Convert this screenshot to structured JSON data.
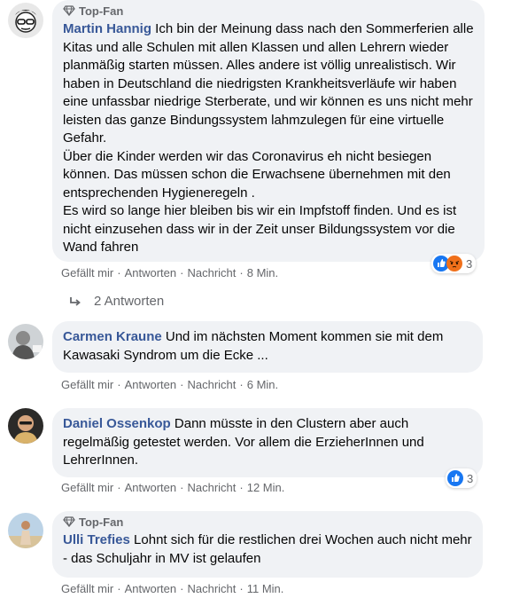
{
  "comments": [
    {
      "top_fan": "Top-Fan",
      "author": "Martin Hannig",
      "text": "Ich bin der Meinung dass nach den Sommerferien alle Kitas und alle Schulen mit allen Klassen und allen Lehrern wieder planmäßig starten müssen. Alles andere ist völlig unrealistisch. Wir haben in Deutschland die niedrigsten Krankheitsverläufe wir haben eine unfassbar niedrige Sterberate, und wir können es uns nicht mehr leisten das ganze Bindungssystem lahmzulegen für eine virtuelle Gefahr.\nÜber die Kinder werden wir das Coronavirus eh nicht besiegen können. Das müssen schon die Erwachsene übernehmen mit den entsprechenden Hygieneregeln .\nEs wird so lange hier bleiben bis wir ein Impfstoff finden. Und es ist nicht einzusehen dass wir in der Zeit unser Bildungssystem vor die Wand fahren",
      "like": "Gefällt mir",
      "reply": "Antworten",
      "message": "Nachricht",
      "time": "8 Min.",
      "reaction_count": "3",
      "reactions": [
        "like-icon",
        "angry-icon"
      ]
    },
    {
      "top_fan": "",
      "author": "Carmen Kraune",
      "text": "Und im nächsten Moment kommen sie mit dem Kawasaki Syndrom um die Ecke ...",
      "like": "Gefällt mir",
      "reply": "Antworten",
      "message": "Nachricht",
      "time": "6 Min."
    },
    {
      "top_fan": "",
      "author": "Daniel Ossenkop",
      "text": "Dann müsste in den Clustern aber auch regelmäßig getestet werden. Vor allem die ErzieherInnen und LehrerInnen.",
      "like": "Gefällt mir",
      "reply": "Antworten",
      "message": "Nachricht",
      "time": "12 Min.",
      "reaction_count": "3",
      "reactions": [
        "like-icon"
      ]
    },
    {
      "top_fan": "Top-Fan",
      "author": "Ulli Trefies",
      "text": "Lohnt sich für die restlichen drei Wochen auch nicht mehr - das Schuljahr in MV ist gelaufen",
      "like": "Gefällt mir",
      "reply": "Antworten",
      "message": "Nachricht",
      "time": "11 Min."
    }
  ],
  "replies_link": "2 Antworten",
  "separator": "·",
  "colors": {
    "author": "#385898",
    "bubble": "#f0f2f5",
    "meta": "#65676b",
    "like_blue": "#1877f2",
    "angry_orange": "#f0701a"
  }
}
